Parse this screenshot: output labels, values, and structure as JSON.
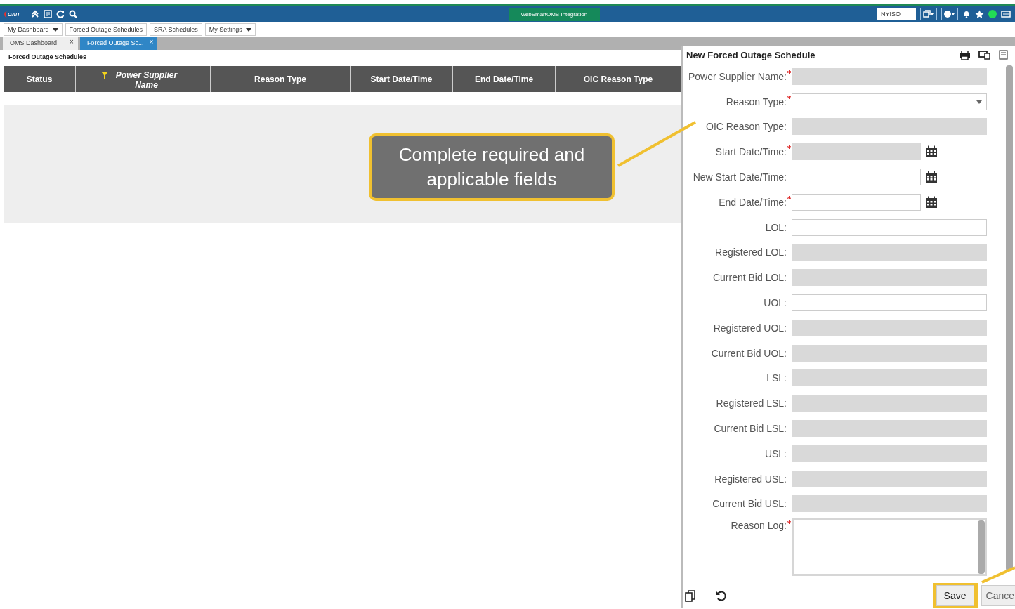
{
  "top_bar": {
    "logo": "OATI",
    "center_tab": "webSmartOMS Integration",
    "company": "NYISO",
    "status_online": true
  },
  "menu": [
    {
      "label": "My Dashboard",
      "dropdown": true
    },
    {
      "label": "Forced Outage Schedules",
      "dropdown": false
    },
    {
      "label": "SRA Schedules",
      "dropdown": false
    },
    {
      "label": "My Settings",
      "dropdown": true
    }
  ],
  "tabs": [
    {
      "label": "OMS Dashboard",
      "selected": false,
      "close": "×"
    },
    {
      "label": "Forced Outage Sc...",
      "selected": true,
      "close": "×"
    }
  ],
  "page_title": "Forced Outage Schedules",
  "table": {
    "columns": [
      {
        "label": "Status",
        "filtered": false
      },
      {
        "label": "Power Supplier Name",
        "filtered": true
      },
      {
        "label": "Reason Type",
        "filtered": false
      },
      {
        "label": "Start Date/Time",
        "filtered": false
      },
      {
        "label": "End Date/Time",
        "filtered": false
      },
      {
        "label": "OIC Reason Type",
        "filtered": false
      }
    ]
  },
  "panel": {
    "title": "New Forced Outage Schedule",
    "fields": [
      {
        "label": "Power Supplier Name:",
        "required": true,
        "kind": "text",
        "disabled": true
      },
      {
        "label": "Reason Type:",
        "required": true,
        "kind": "select",
        "disabled": false
      },
      {
        "label": "OIC Reason Type:",
        "required": false,
        "kind": "text",
        "disabled": true
      },
      {
        "label": "Start Date/Time:",
        "required": true,
        "kind": "date",
        "disabled": true
      },
      {
        "label": "New Start Date/Time:",
        "required": false,
        "kind": "date",
        "disabled": false
      },
      {
        "label": "End Date/Time:",
        "required": true,
        "kind": "date",
        "disabled": false
      },
      {
        "label": "LOL:",
        "required": false,
        "kind": "text",
        "disabled": false
      },
      {
        "label": "Registered LOL:",
        "required": false,
        "kind": "text",
        "disabled": true
      },
      {
        "label": "Current Bid LOL:",
        "required": false,
        "kind": "text",
        "disabled": true
      },
      {
        "label": "UOL:",
        "required": false,
        "kind": "text",
        "disabled": false
      },
      {
        "label": "Registered UOL:",
        "required": false,
        "kind": "text",
        "disabled": true
      },
      {
        "label": "Current Bid UOL:",
        "required": false,
        "kind": "text",
        "disabled": true
      },
      {
        "label": "LSL:",
        "required": false,
        "kind": "text",
        "disabled": true
      },
      {
        "label": "Registered LSL:",
        "required": false,
        "kind": "text",
        "disabled": true
      },
      {
        "label": "Current Bid LSL:",
        "required": false,
        "kind": "text",
        "disabled": true
      },
      {
        "label": "USL:",
        "required": false,
        "kind": "text",
        "disabled": true
      },
      {
        "label": "Registered USL:",
        "required": false,
        "kind": "text",
        "disabled": true
      },
      {
        "label": "Current Bid USL:",
        "required": false,
        "kind": "text",
        "disabled": true
      },
      {
        "label": "Reason Log:",
        "required": true,
        "kind": "textarea",
        "disabled": false
      }
    ],
    "buttons": [
      {
        "label": "Save",
        "highlighted": true
      },
      {
        "label": "Cance",
        "highlighted": false
      }
    ]
  },
  "annotations": [
    {
      "text": "Complete required and applicable fields"
    }
  ]
}
